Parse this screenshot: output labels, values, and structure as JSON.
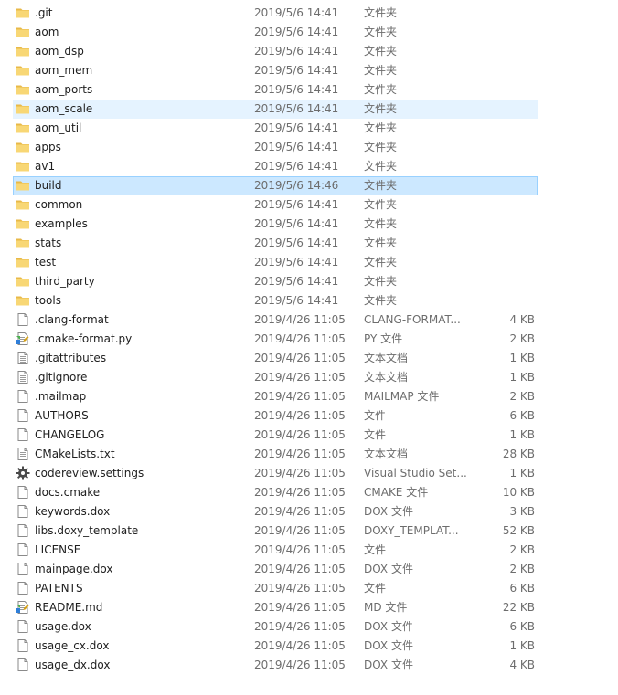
{
  "colors": {
    "folder": "#f8d775",
    "folder_tab": "#e8b948",
    "selected_bg": "#cce8ff",
    "selected_border": "#99d1ff",
    "hover_bg": "#e5f3ff",
    "secondary_text": "#6d6d6d"
  },
  "files": [
    {
      "name": ".git",
      "date": "2019/5/6 14:41",
      "type": "文件夹",
      "size": "",
      "icon": "folder-icon",
      "state": ""
    },
    {
      "name": "aom",
      "date": "2019/5/6 14:41",
      "type": "文件夹",
      "size": "",
      "icon": "folder-icon",
      "state": ""
    },
    {
      "name": "aom_dsp",
      "date": "2019/5/6 14:41",
      "type": "文件夹",
      "size": "",
      "icon": "folder-icon",
      "state": ""
    },
    {
      "name": "aom_mem",
      "date": "2019/5/6 14:41",
      "type": "文件夹",
      "size": "",
      "icon": "folder-icon",
      "state": ""
    },
    {
      "name": "aom_ports",
      "date": "2019/5/6 14:41",
      "type": "文件夹",
      "size": "",
      "icon": "folder-icon",
      "state": ""
    },
    {
      "name": "aom_scale",
      "date": "2019/5/6 14:41",
      "type": "文件夹",
      "size": "",
      "icon": "folder-icon",
      "state": "hover"
    },
    {
      "name": "aom_util",
      "date": "2019/5/6 14:41",
      "type": "文件夹",
      "size": "",
      "icon": "folder-icon",
      "state": ""
    },
    {
      "name": "apps",
      "date": "2019/5/6 14:41",
      "type": "文件夹",
      "size": "",
      "icon": "folder-icon",
      "state": ""
    },
    {
      "name": "av1",
      "date": "2019/5/6 14:41",
      "type": "文件夹",
      "size": "",
      "icon": "folder-icon",
      "state": ""
    },
    {
      "name": "build",
      "date": "2019/5/6 14:46",
      "type": "文件夹",
      "size": "",
      "icon": "folder-icon",
      "state": "selected"
    },
    {
      "name": "common",
      "date": "2019/5/6 14:41",
      "type": "文件夹",
      "size": "",
      "icon": "folder-icon",
      "state": ""
    },
    {
      "name": "examples",
      "date": "2019/5/6 14:41",
      "type": "文件夹",
      "size": "",
      "icon": "folder-icon",
      "state": ""
    },
    {
      "name": "stats",
      "date": "2019/5/6 14:41",
      "type": "文件夹",
      "size": "",
      "icon": "folder-icon",
      "state": ""
    },
    {
      "name": "test",
      "date": "2019/5/6 14:41",
      "type": "文件夹",
      "size": "",
      "icon": "folder-icon",
      "state": ""
    },
    {
      "name": "third_party",
      "date": "2019/5/6 14:41",
      "type": "文件夹",
      "size": "",
      "icon": "folder-icon",
      "state": ""
    },
    {
      "name": "tools",
      "date": "2019/5/6 14:41",
      "type": "文件夹",
      "size": "",
      "icon": "folder-icon",
      "state": ""
    },
    {
      "name": ".clang-format",
      "date": "2019/4/26 11:05",
      "type": "CLANG-FORMAT...",
      "size": "4 KB",
      "icon": "file-icon",
      "state": ""
    },
    {
      "name": ".cmake-format.py",
      "date": "2019/4/26 11:05",
      "type": "PY 文件",
      "size": "2 KB",
      "icon": "python-file-icon",
      "state": ""
    },
    {
      "name": ".gitattributes",
      "date": "2019/4/26 11:05",
      "type": "文本文档",
      "size": "1 KB",
      "icon": "text-file-icon",
      "state": ""
    },
    {
      "name": ".gitignore",
      "date": "2019/4/26 11:05",
      "type": "文本文档",
      "size": "1 KB",
      "icon": "text-file-icon",
      "state": ""
    },
    {
      "name": ".mailmap",
      "date": "2019/4/26 11:05",
      "type": "MAILMAP 文件",
      "size": "2 KB",
      "icon": "file-icon",
      "state": ""
    },
    {
      "name": "AUTHORS",
      "date": "2019/4/26 11:05",
      "type": "文件",
      "size": "6 KB",
      "icon": "file-icon",
      "state": ""
    },
    {
      "name": "CHANGELOG",
      "date": "2019/4/26 11:05",
      "type": "文件",
      "size": "1 KB",
      "icon": "file-icon",
      "state": ""
    },
    {
      "name": "CMakeLists.txt",
      "date": "2019/4/26 11:05",
      "type": "文本文档",
      "size": "28 KB",
      "icon": "text-file-icon",
      "state": ""
    },
    {
      "name": "codereview.settings",
      "date": "2019/4/26 11:05",
      "type": "Visual Studio Set...",
      "size": "1 KB",
      "icon": "settings-gear-icon",
      "state": ""
    },
    {
      "name": "docs.cmake",
      "date": "2019/4/26 11:05",
      "type": "CMAKE 文件",
      "size": "10 KB",
      "icon": "file-icon",
      "state": ""
    },
    {
      "name": "keywords.dox",
      "date": "2019/4/26 11:05",
      "type": "DOX 文件",
      "size": "3 KB",
      "icon": "file-icon",
      "state": ""
    },
    {
      "name": "libs.doxy_template",
      "date": "2019/4/26 11:05",
      "type": "DOXY_TEMPLAT...",
      "size": "52 KB",
      "icon": "file-icon",
      "state": ""
    },
    {
      "name": "LICENSE",
      "date": "2019/4/26 11:05",
      "type": "文件",
      "size": "2 KB",
      "icon": "file-icon",
      "state": ""
    },
    {
      "name": "mainpage.dox",
      "date": "2019/4/26 11:05",
      "type": "DOX 文件",
      "size": "2 KB",
      "icon": "file-icon",
      "state": ""
    },
    {
      "name": "PATENTS",
      "date": "2019/4/26 11:05",
      "type": "文件",
      "size": "6 KB",
      "icon": "file-icon",
      "state": ""
    },
    {
      "name": "README.md",
      "date": "2019/4/26 11:05",
      "type": "MD 文件",
      "size": "22 KB",
      "icon": "markdown-file-icon",
      "state": ""
    },
    {
      "name": "usage.dox",
      "date": "2019/4/26 11:05",
      "type": "DOX 文件",
      "size": "6 KB",
      "icon": "file-icon",
      "state": ""
    },
    {
      "name": "usage_cx.dox",
      "date": "2019/4/26 11:05",
      "type": "DOX 文件",
      "size": "1 KB",
      "icon": "file-icon",
      "state": ""
    },
    {
      "name": "usage_dx.dox",
      "date": "2019/4/26 11:05",
      "type": "DOX 文件",
      "size": "4 KB",
      "icon": "file-icon",
      "state": ""
    }
  ]
}
